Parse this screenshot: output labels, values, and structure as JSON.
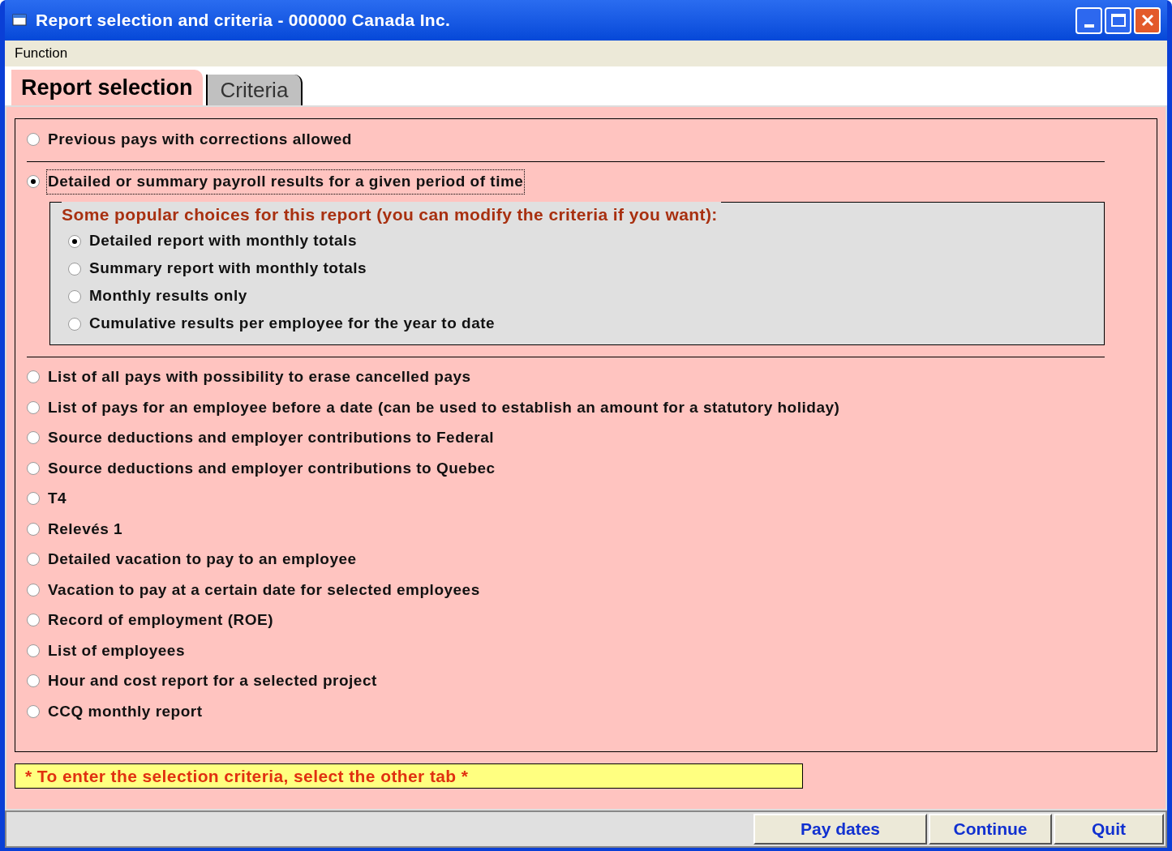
{
  "window": {
    "title": "Report selection and criteria - 000000 Canada Inc."
  },
  "menu": [
    "Function"
  ],
  "tabs": [
    {
      "label": "Report selection",
      "selected": true
    },
    {
      "label": "Criteria",
      "selected": false
    }
  ],
  "sections": [
    [
      {
        "label": "Previous pays with corrections allowed",
        "selected": false
      }
    ],
    [
      {
        "label": "Detailed or summary payroll results for a given period of time",
        "selected": true,
        "focused": true,
        "presets": {
          "title": "Some popular choices for this report (you can modify the criteria if you want):",
          "options": [
            {
              "label": "Detailed report with monthly totals",
              "selected": true
            },
            {
              "label": "Summary report with monthly totals",
              "selected": false
            },
            {
              "label": "Monthly results only",
              "selected": false
            },
            {
              "label": "Cumulative results per employee for the year to date",
              "selected": false
            }
          ]
        }
      }
    ],
    [
      {
        "label": "List of all pays with possibility to erase cancelled pays",
        "selected": false
      },
      {
        "label": "List of pays for an employee before a date (can be used to establish an amount for a statutory holiday)",
        "selected": false
      },
      {
        "label": "Source deductions and employer contributions to Federal",
        "selected": false
      },
      {
        "label": "Source deductions and employer contributions to Quebec",
        "selected": false
      },
      {
        "label": "T4",
        "selected": false
      },
      {
        "label": "Relevés 1",
        "selected": false
      },
      {
        "label": "Detailed vacation to pay to an employee",
        "selected": false
      },
      {
        "label": "Vacation to pay at a certain date for selected employees",
        "selected": false
      },
      {
        "label": "Record of employment (ROE)",
        "selected": false
      },
      {
        "label": "List of employees",
        "selected": false
      },
      {
        "label": "Hour and cost report for a selected project",
        "selected": false
      },
      {
        "label": "CCQ monthly report",
        "selected": false
      }
    ]
  ],
  "notice": "* To enter the selection criteria, select the other tab *",
  "buttons": [
    "Pay dates",
    "Continue",
    "Quit"
  ]
}
